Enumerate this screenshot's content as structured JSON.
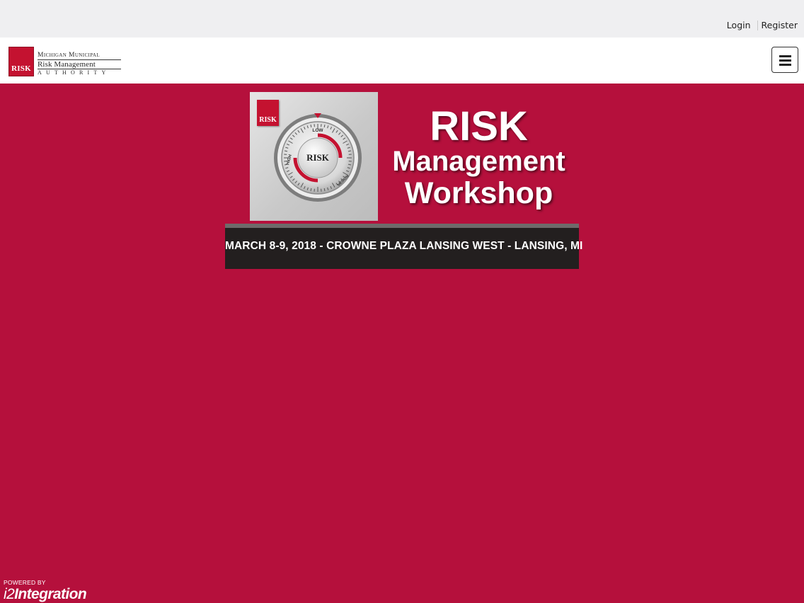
{
  "topbar": {
    "login_label": "Login",
    "register_label": "Register"
  },
  "header": {
    "logo": {
      "badge_text": "RISK",
      "line1": "Michigan Municipal",
      "line2": "Risk Management",
      "line3": "AUTHORITY"
    },
    "menu_icon": "hamburger-menu-icon"
  },
  "banner": {
    "card_badge_text": "RISK",
    "dial": {
      "center_text": "RISK",
      "label_low": "LOW",
      "label_high": "HIGH",
      "label_medium": "MEDIUM"
    },
    "title_line1": "RISK",
    "title_line2": "Management",
    "title_line3": "Workshop",
    "date_text": "MARCH 8-9, 2018 - CROWNE PLAZA LANSING WEST - LANSING, MI"
  },
  "footer": {
    "powered_by": "POWERED BY",
    "brand_prefix": "i2",
    "brand_name": "Integration"
  },
  "colors": {
    "page_background": "#b5103c",
    "topbar_background": "#efeff1",
    "brand_red": "#c41230",
    "date_band": "#231f1f"
  }
}
